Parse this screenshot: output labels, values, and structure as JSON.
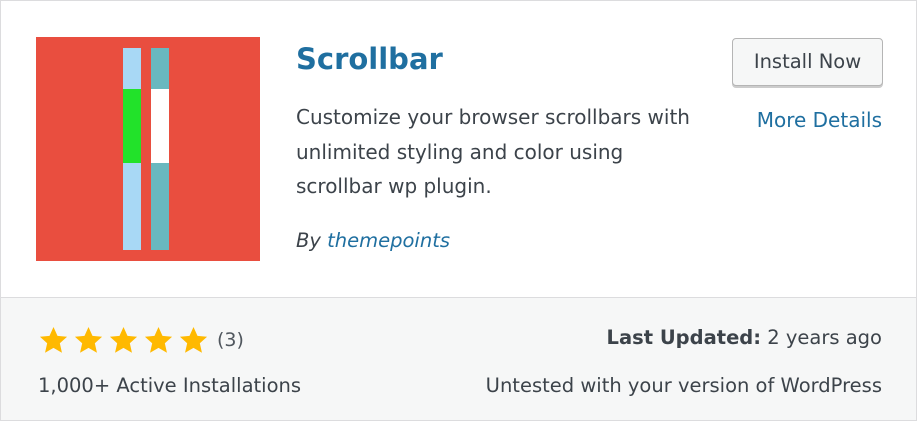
{
  "plugin": {
    "title": "Scrollbar",
    "description": "Customize your browser scrollbars with unlimited styling and color using scrollbar wp plugin.",
    "author_prefix": "By",
    "author_name": "themepoints",
    "icon": {
      "name": "scrollbar-plugin-icon",
      "background_color": "#e94e3f",
      "bar1_track_color": "#a8d8f5",
      "bar1_thumb_color": "#22e22a",
      "bar2_track_color": "#69b8bf",
      "bar2_thumb_color": "#ffffff"
    }
  },
  "actions": {
    "install_label": "Install Now",
    "more_details_label": "More Details"
  },
  "footer": {
    "rating": {
      "stars": 5,
      "max": 5,
      "count_label": "(3)",
      "star_color": "#ffb900"
    },
    "active_installs": "1,000+ Active Installations",
    "last_updated_label": "Last Updated:",
    "last_updated_value": "2 years ago",
    "compatibility": "Untested with your version of WordPress"
  },
  "colors": {
    "link": "#1f6fa0",
    "text": "#3c434a",
    "footer_bg": "#f6f7f7"
  }
}
